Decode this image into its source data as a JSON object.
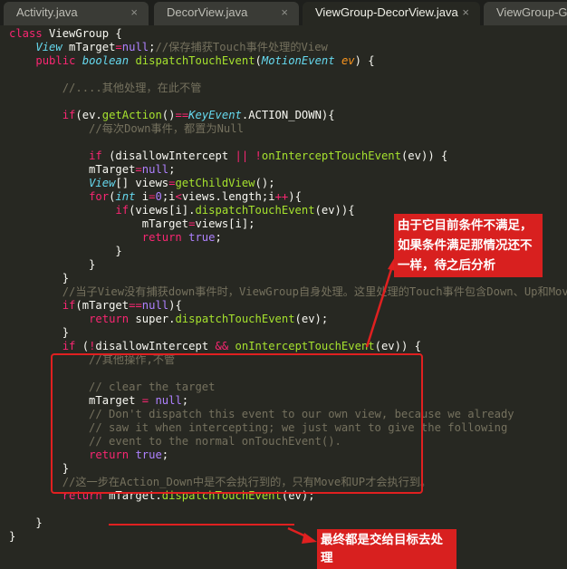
{
  "tabs": [
    {
      "label": "Activity.java",
      "close": "×"
    },
    {
      "label": "DecorView.java",
      "close": "×"
    },
    {
      "label": "ViewGroup-DecorView.java",
      "close": "×"
    },
    {
      "label": "ViewGroup-Gra",
      "close": ""
    }
  ],
  "code": {
    "l1": {
      "a": "class ",
      "b": "ViewGroup",
      "c": " {"
    },
    "l2": {
      "a": "    ",
      "b": "View",
      "c": " mTarget",
      "d": "=",
      "e": "null",
      "f": ";",
      "g": "//保存捕获Touch事件处理的View"
    },
    "l3": {
      "a": "    ",
      "b": "public",
      "c": " ",
      "d": "boolean",
      "e": " ",
      "f": "dispatchTouchEvent",
      "g": "(",
      "h": "MotionEvent",
      "i": " ",
      "j": "ev",
      "k": ") {"
    },
    "l5": "        //....其他处理，在此不管",
    "l7": {
      "a": "        ",
      "b": "if",
      "c": "(ev.",
      "d": "getAction",
      "e": "()",
      "f": "==",
      "g": "KeyEvent",
      "h": ".ACTION_DOWN){"
    },
    "l8": "            //每次Down事件，都置为Null",
    "l10": {
      "a": "            ",
      "b": "if",
      "c": " (disallowIntercept ",
      "d": "||",
      "e": " ",
      "f": "!",
      "g": "onInterceptTouchEvent",
      "h": "(ev)) {"
    },
    "l11": {
      "a": "            mTarget",
      "b": "=",
      "c": "null",
      "d": ";"
    },
    "l12": {
      "a": "            ",
      "b": "View",
      "c": "[] views",
      "d": "=",
      "e": "getChildView",
      "f": "();"
    },
    "l13": {
      "a": "            ",
      "b": "for",
      "c": "(",
      "d": "int",
      "e": " i",
      "f": "=",
      "g": "0",
      "h": ";i",
      "i": "<",
      "j": "views.length;i",
      "k": "++",
      "l": "){"
    },
    "l14": {
      "a": "                ",
      "b": "if",
      "c": "(views[i].",
      "d": "dispatchTouchEvent",
      "e": "(ev)){"
    },
    "l15": {
      "a": "                    mTarget",
      "b": "=",
      "c": "views[i];"
    },
    "l16": {
      "a": "                    ",
      "b": "return",
      "c": " ",
      "d": "true",
      "e": ";"
    },
    "l17": "                }",
    "l18": "            }",
    "l19": "        }",
    "l20": "        //当子View没有捕获down事件时，ViewGroup自身处理。这里处理的Touch事件包含Down、Up和Move",
    "l21": {
      "a": "        ",
      "b": "if",
      "c": "(mTarget",
      "d": "==",
      "e": "null",
      "f": "){"
    },
    "l22": {
      "a": "            ",
      "b": "return",
      "c": " super.",
      "d": "dispatchTouchEvent",
      "e": "(ev);"
    },
    "l23": "        }",
    "l24": {
      "a": "        ",
      "b": "if",
      "c": " (",
      "d": "!",
      "e": "disallowIntercept ",
      "f": "&&",
      "g": " ",
      "h": "onInterceptTouchEvent",
      "i": "(ev)) {"
    },
    "l25": "            //其他操作,不管",
    "l27": "            // clear the target",
    "l28": {
      "a": "            mTarget ",
      "b": "=",
      "c": " ",
      "d": "null",
      "e": ";"
    },
    "l29": "            // Don't dispatch this event to our own view, because we already",
    "l30": "            // saw it when intercepting; we just want to give the following",
    "l31": "            // event to the normal onTouchEvent().",
    "l32": {
      "a": "            ",
      "b": "return",
      "c": " ",
      "d": "true",
      "e": ";"
    },
    "l33": "        }",
    "l34": "        //这一步在Action_Down中是不会执行到的，只有Move和UP才会执行到。",
    "l35": {
      "a": "        ",
      "b": "return",
      "c": " mTarget.",
      "d": "dispatchTouchEvent",
      "e": "(ev);"
    },
    "l37": "    }",
    "l38": "}"
  },
  "annotations": {
    "note1": "由于它目前条件不满足，如果条件满足那情况还不一样，待之后分析",
    "note2": "最终都是交给目标去处理"
  },
  "colors": {
    "background": "#272822",
    "highlight": "#e02020"
  }
}
